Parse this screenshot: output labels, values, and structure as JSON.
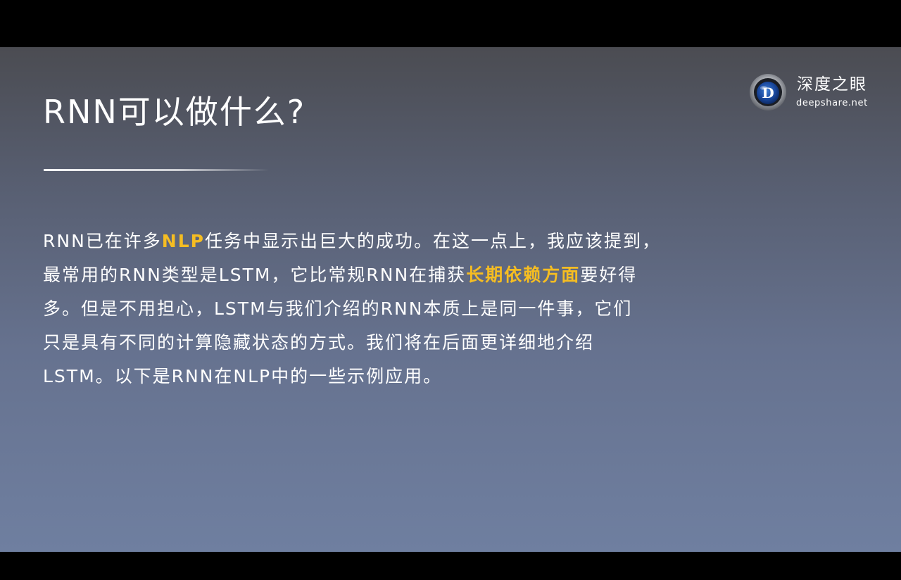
{
  "slide": {
    "title": "RNN可以做什么?",
    "brand": {
      "name": "深度之眼",
      "url": "deepshare.net",
      "logo_icon": "deepshare-eye-logo-icon",
      "logo_letter": "D"
    },
    "colors": {
      "text": "#ffffff",
      "highlight": "#f5bd22",
      "background_top": "#4b4c52",
      "background_bottom": "#6f7fa0",
      "letterbox": "#000000"
    },
    "paragraph": {
      "line1": {
        "before": "RNN已在许多",
        "highlight": "NLP",
        "after": "任务中显示出巨大的成功。在这一点上，我应该提到，"
      },
      "line2": {
        "before": "最常用的RNN类型是LSTM，它比常规RNN在捕获",
        "highlight": "长期依赖方面",
        "after": "要好得"
      },
      "line3": "多。但是不用担心，LSTM与我们介绍的RNN本质上是同一件事，它们",
      "line4": "只是具有不同的计算隐藏状态的方式。我们将在后面更详细地介绍",
      "line5": "LSTM。以下是RNN在NLP中的一些示例应用。"
    }
  }
}
